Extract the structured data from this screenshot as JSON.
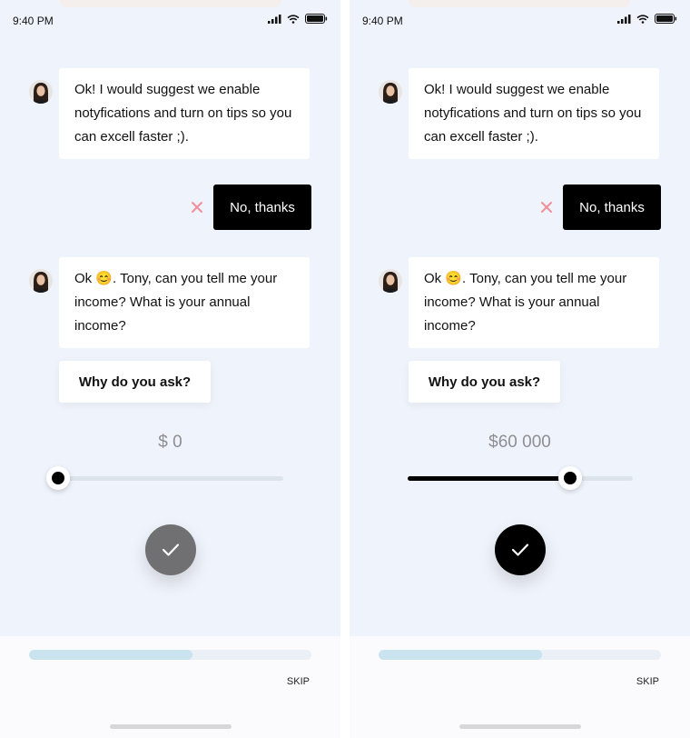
{
  "screens": [
    {
      "status": {
        "time": "9:40 PM"
      },
      "messages": [
        {
          "text": "Ok! I would suggest we enable notyfications and turn on tips so you can excell faster ;)."
        },
        {
          "text_before": "Ok ",
          "emoji": "😊",
          "text_after": ". Tony, can you tell me your income? What is your annual income?"
        }
      ],
      "reply_label": "No, thanks",
      "why_label": "Why do you ask?",
      "slider": {
        "display": "$ 0",
        "fraction": 0.0
      },
      "confirm": {
        "enabled": false,
        "color": "#707072"
      },
      "progress": {
        "fraction": 0.58
      },
      "skip_label": "SKIP"
    },
    {
      "status": {
        "time": "9:40 PM"
      },
      "messages": [
        {
          "text": "Ok! I would suggest we enable notyfications and turn on tips so you can excell faster ;)."
        },
        {
          "text_before": "Ok ",
          "emoji": "😊",
          "text_after": ". Tony, can you tell me your income? What is your annual income?"
        }
      ],
      "reply_label": "No, thanks",
      "why_label": "Why do you ask?",
      "slider": {
        "display": "$60 000",
        "fraction": 0.72
      },
      "confirm": {
        "enabled": true,
        "color": "#000000"
      },
      "progress": {
        "fraction": 0.58
      },
      "skip_label": "SKIP"
    }
  ],
  "colors": {
    "background": "#eff3fb",
    "dismiss_x": "#f08f99",
    "progress_fill": "#c9e3ef",
    "slider_fill": "#000000"
  },
  "icons": {
    "dismiss": "close-icon",
    "confirm": "checkmark-icon",
    "signal": "signal-icon",
    "wifi": "wifi-icon",
    "battery": "battery-icon"
  }
}
